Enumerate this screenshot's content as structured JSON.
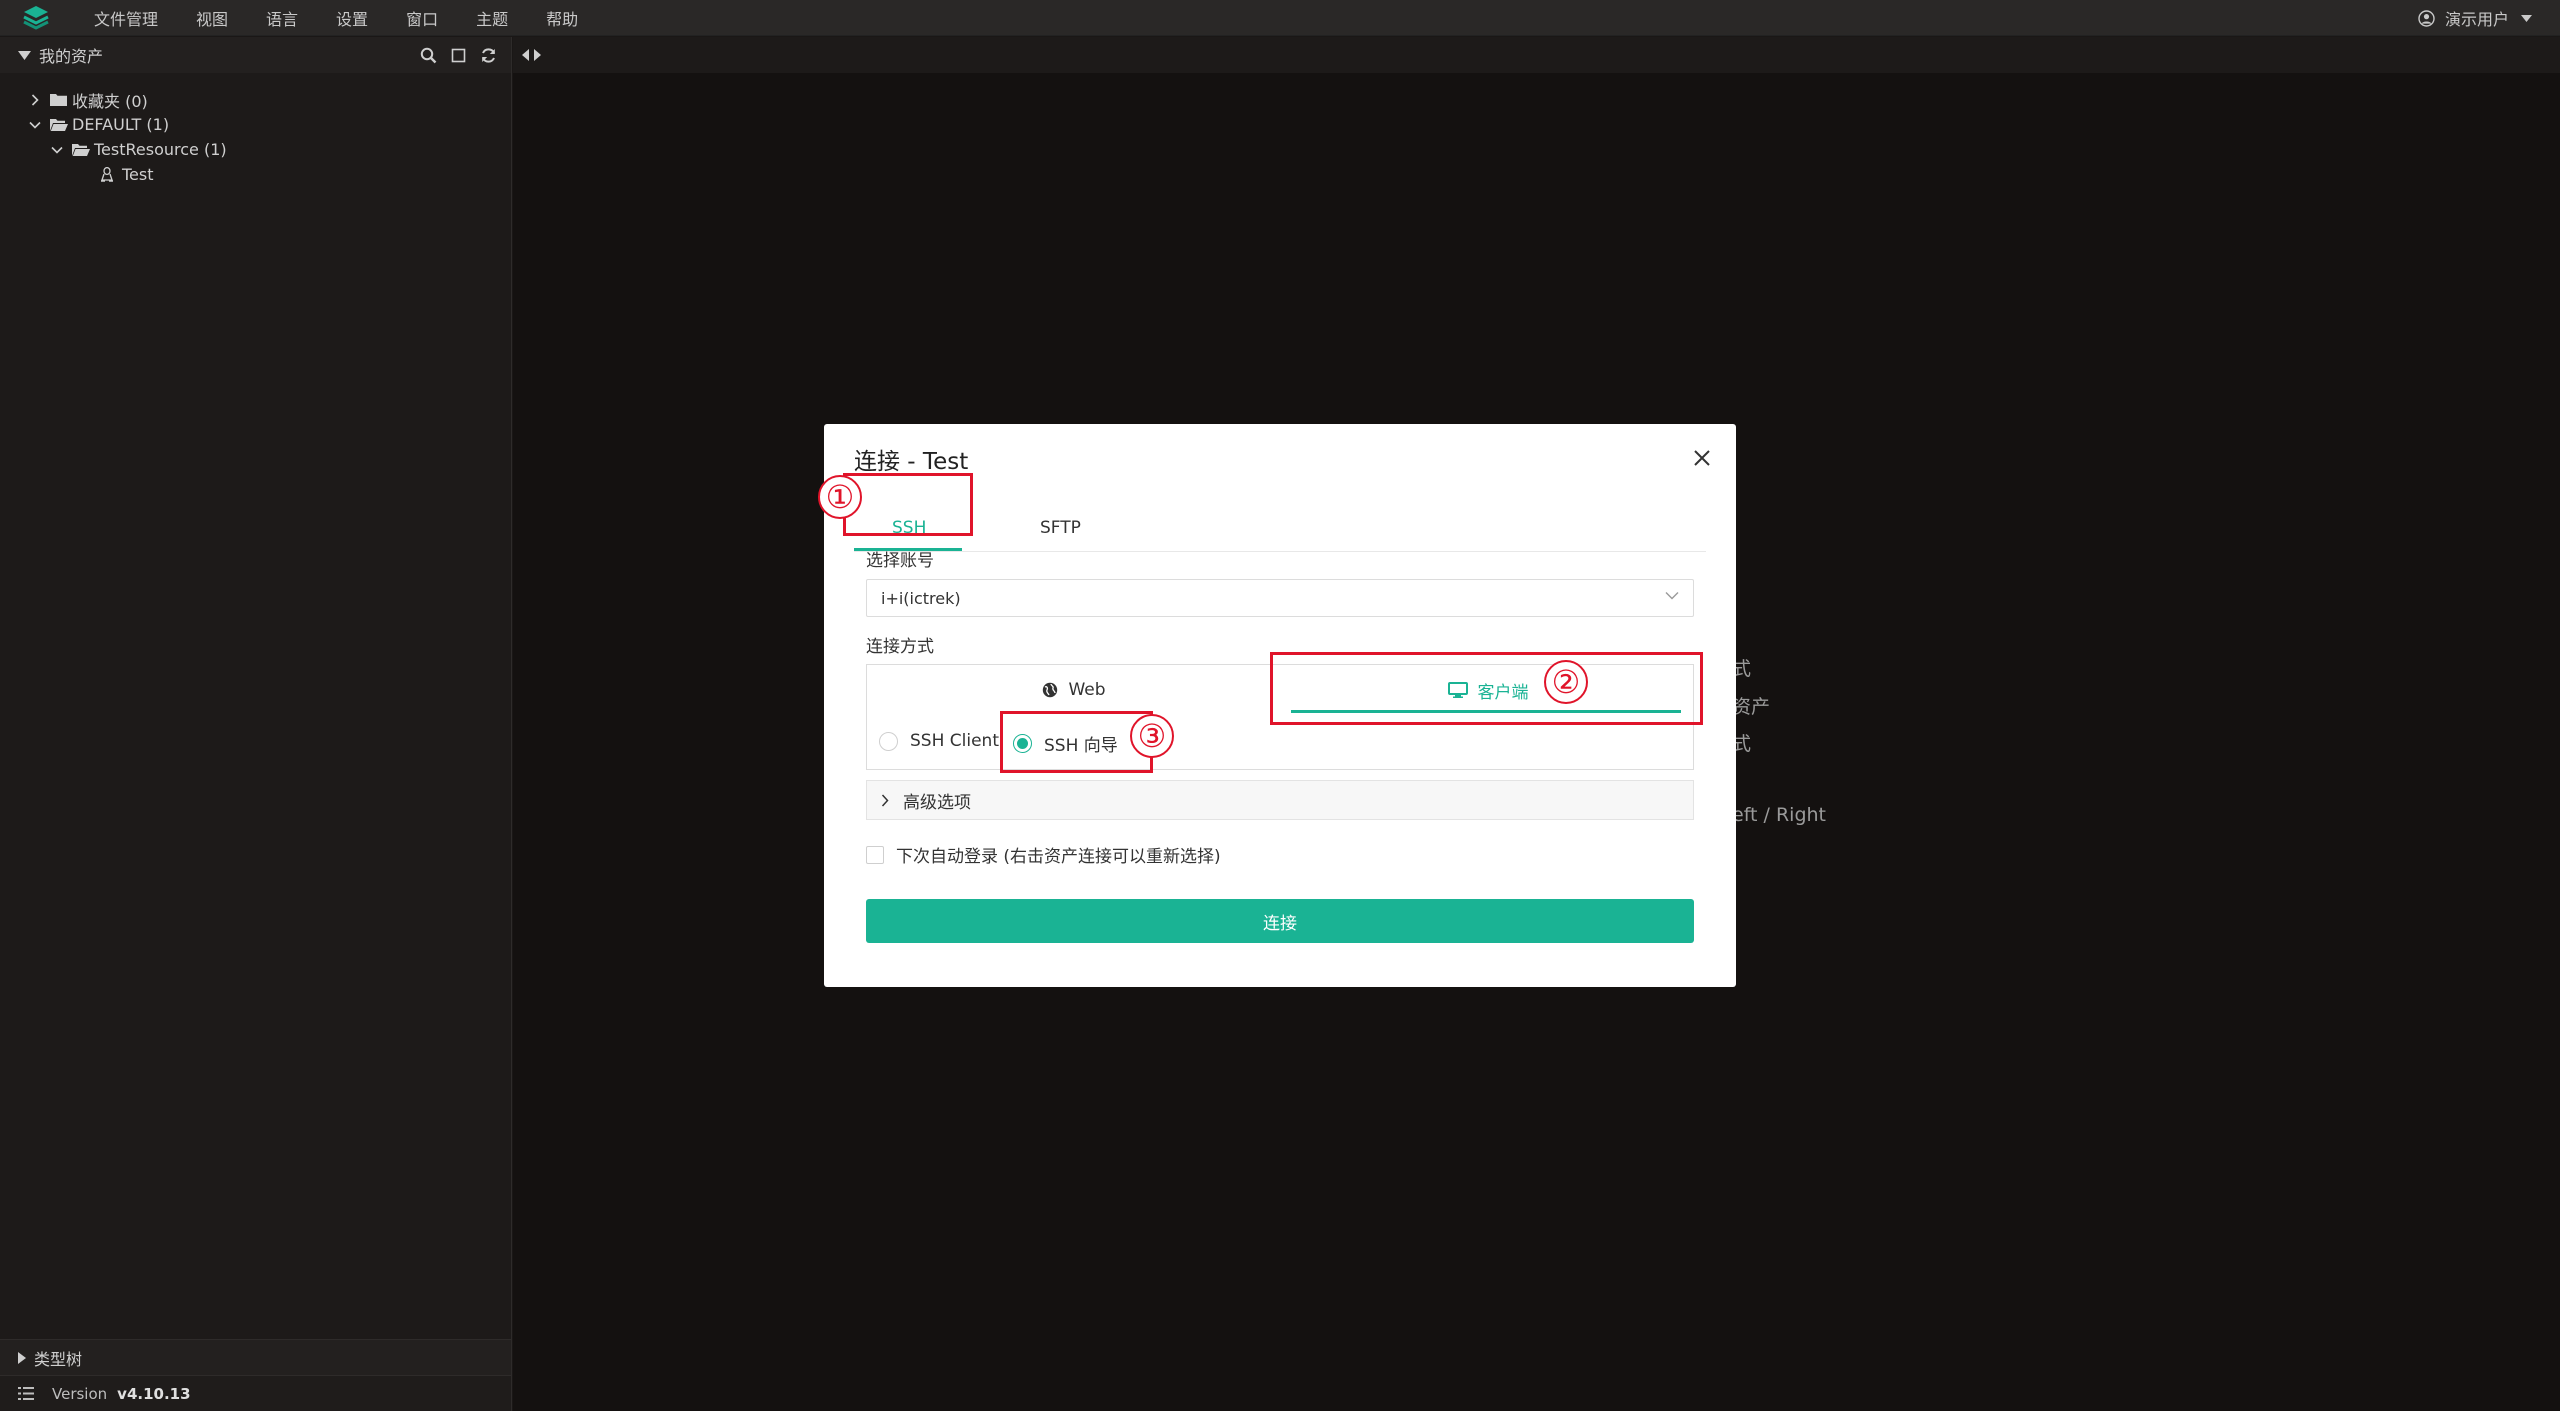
{
  "menubar": {
    "items": [
      "文件管理",
      "视图",
      "语言",
      "设置",
      "窗口",
      "主题",
      "帮助"
    ],
    "user": "演示用户"
  },
  "sidebar": {
    "header": "我的资产",
    "tree": [
      {
        "label": "收藏夹 (0)",
        "expanded": false
      },
      {
        "label": "DEFAULT (1)",
        "expanded": true
      },
      {
        "label": "TestResource (1)",
        "expanded": true
      },
      {
        "label": "Test",
        "icon": "linux-icon"
      }
    ],
    "type_tree": "类型树",
    "version_label": "Version",
    "version_value": "v4.10.13"
  },
  "background_hints": {
    "line1": "式",
    "line2": "资产",
    "line3": "式",
    "line4": "eft / Right"
  },
  "modal": {
    "title": "连接 - Test",
    "tabs": [
      "SSH",
      "SFTP"
    ],
    "active_tab": "SSH",
    "account_label": "选择账号",
    "account_value": "i+i(ictrek)",
    "method_label": "连接方式",
    "method_tabs": [
      "Web",
      "客户端"
    ],
    "active_method": "客户端",
    "radios": [
      {
        "label": "SSH Client",
        "checked": false
      },
      {
        "label": "SSH 向导",
        "checked": true
      }
    ],
    "advanced": "高级选项",
    "auto_login": "下次自动登录 (右击资产连接可以重新选择)",
    "connect": "连接"
  },
  "annotations": [
    "①",
    "②",
    "③"
  ],
  "colors": {
    "accent": "#1ab394",
    "annotation": "#e0142a",
    "background": "#141110"
  }
}
